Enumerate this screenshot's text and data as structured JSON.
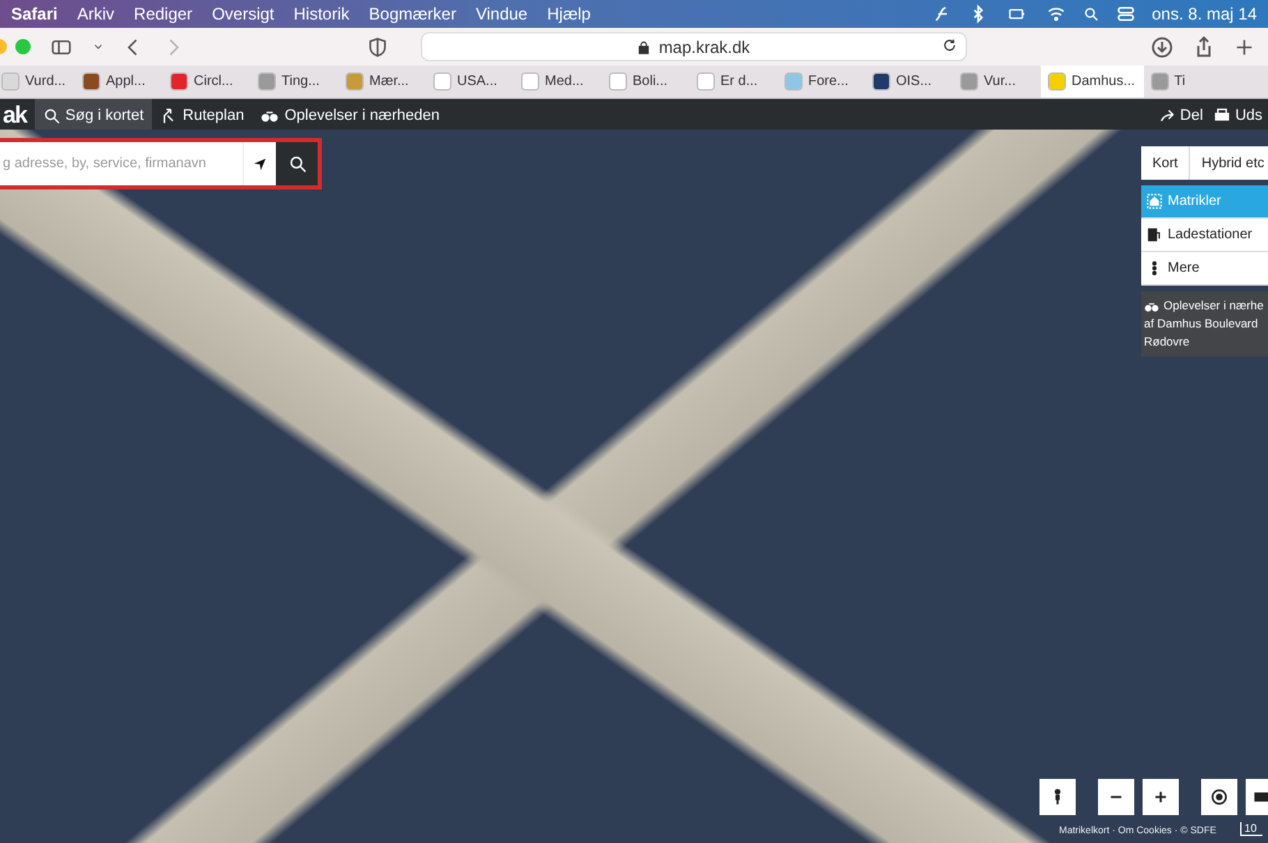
{
  "menu_bar": {
    "items": [
      {
        "label": "Safari",
        "bold": true
      },
      {
        "label": "Arkiv",
        "bold": false
      },
      {
        "label": "Rediger",
        "bold": false
      },
      {
        "label": "Oversigt",
        "bold": false
      },
      {
        "label": "Historik",
        "bold": false
      },
      {
        "label": "Bogmærker",
        "bold": false
      },
      {
        "label": "Vindue",
        "bold": false
      },
      {
        "label": "Hjælp",
        "bold": false
      }
    ],
    "clock": "ons. 8. maj 14"
  },
  "browser": {
    "url": "map.krak.dk"
  },
  "tabs": [
    {
      "label": "Vurd...",
      "selected": false,
      "color": "#d9d9d9"
    },
    {
      "label": "Appl...",
      "selected": false,
      "color": "#8a4b1f"
    },
    {
      "label": "Circl...",
      "selected": false,
      "color": "#e3242b"
    },
    {
      "label": "Ting...",
      "selected": false,
      "color": "#9a9a9a"
    },
    {
      "label": "Mær...",
      "selected": false,
      "color": "#c79a3a"
    },
    {
      "label": "USA...",
      "selected": false,
      "color": "#ffffff"
    },
    {
      "label": "Med...",
      "selected": false,
      "color": "#ffffff"
    },
    {
      "label": "Boli...",
      "selected": false,
      "color": "#ffffff"
    },
    {
      "label": "Er d...",
      "selected": false,
      "color": "#ffffff"
    },
    {
      "label": "Fore...",
      "selected": false,
      "color": "#8ec6e6"
    },
    {
      "label": "OIS...",
      "selected": false,
      "color": "#1f3a6b"
    },
    {
      "label": "Vur...",
      "selected": false,
      "color": "#9a9a9a"
    },
    {
      "label": "Damhus...",
      "selected": true,
      "color": "#f5d000"
    },
    {
      "label": "Ti",
      "selected": false,
      "color": "#9a9a9a"
    }
  ],
  "app_bar": {
    "logo": "ak",
    "nav": [
      {
        "label": "Søg i kortet",
        "selected": true
      },
      {
        "label": "Ruteplan",
        "selected": false
      },
      {
        "label": "Oplevelser i nærheden",
        "selected": false
      }
    ],
    "actions": [
      "Del",
      "Uds"
    ]
  },
  "search": {
    "placeholder": "g adresse, by, service, firmanavn"
  },
  "map_types": [
    {
      "label": "Kort",
      "selected": false
    },
    {
      "label": "Hybrid etc",
      "selected": false
    }
  ],
  "layers": [
    {
      "label": "Matrikler",
      "selected": true,
      "kind": "house"
    },
    {
      "label": "Ladestationer",
      "selected": false,
      "kind": "charger"
    },
    {
      "label": "Mere",
      "selected": false,
      "kind": "more"
    }
  ],
  "info_box": {
    "lines": [
      "Oplevelser i nærhe",
      "af Damhus Boulevard",
      "Rødovre"
    ]
  },
  "attribution": "Matrikelkort · Om Cookies · © SDFE",
  "scale": "10"
}
